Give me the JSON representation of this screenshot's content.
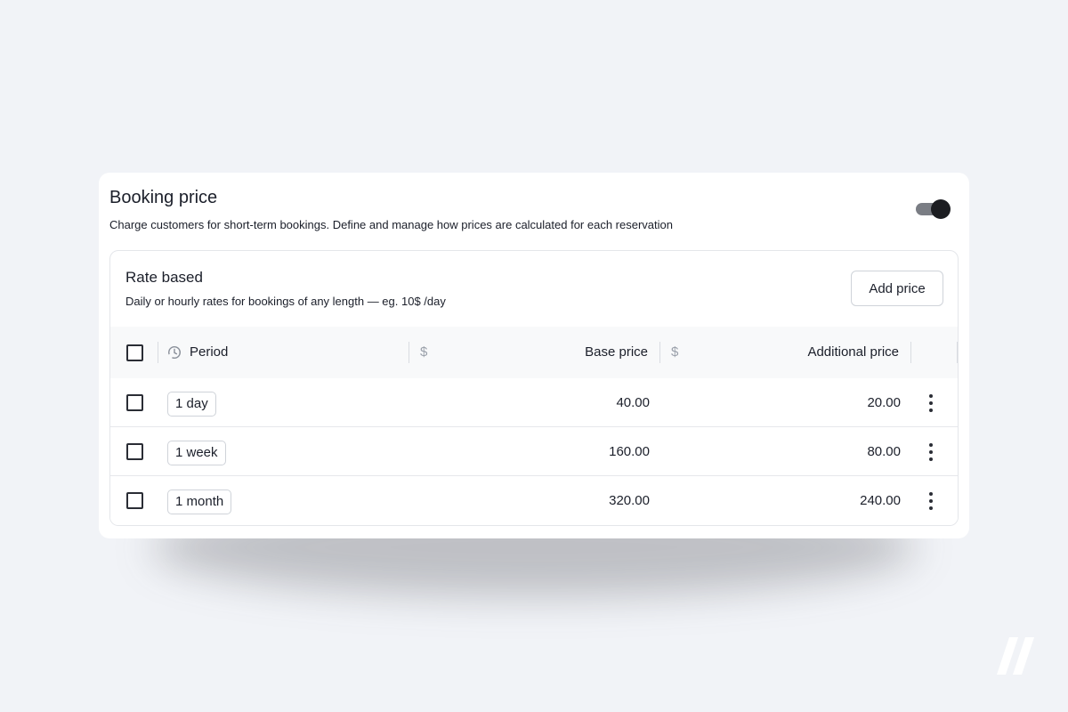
{
  "booking": {
    "title": "Booking price",
    "subtitle": "Charge customers for short-term bookings. Define and manage how prices are calculated for each reservation",
    "toggle_on": true
  },
  "rate": {
    "title": "Rate based",
    "subtitle": "Daily or hourly rates for bookings of any length — eg. 10$ /day",
    "add_button": "Add price"
  },
  "table": {
    "columns": {
      "period": "Period",
      "currency_symbol": "$",
      "base_price": "Base price",
      "additional_price": "Additional price"
    },
    "rows": [
      {
        "period": "1 day",
        "base_price": "40.00",
        "additional_price": "20.00"
      },
      {
        "period": "1 week",
        "base_price": "160.00",
        "additional_price": "80.00"
      },
      {
        "period": "1 month",
        "base_price": "320.00",
        "additional_price": "240.00"
      }
    ]
  },
  "icons": {
    "period_header": "clock-icon",
    "row_menu": "more-vertical-icon",
    "watermark": "double-slash-logo"
  },
  "colors": {
    "background": "#f1f3f7",
    "text": "#1b1f2a",
    "muted": "#9aa0aa",
    "toggle_knob": "#1c1d21"
  }
}
